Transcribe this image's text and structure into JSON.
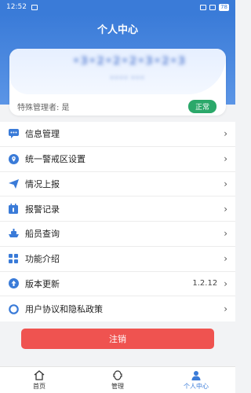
{
  "status_bar": {
    "time": "12:52",
    "battery": "78"
  },
  "header": {
    "title": "个人中心"
  },
  "profile": {
    "name_blurred": "•3•2•2•2•3•2•3",
    "sub_blurred": "•••• •••",
    "admin_label": "特殊管理者: 是",
    "status": "正常",
    "status_color": "#2ba86a"
  },
  "menu": {
    "items": [
      {
        "label": "信息管理",
        "icon": "message-icon"
      },
      {
        "label": "统一警戒区设置",
        "icon": "location-pin-icon"
      },
      {
        "label": "情况上报",
        "icon": "send-icon"
      },
      {
        "label": "报警记录",
        "icon": "calendar-icon"
      },
      {
        "label": "船员查询",
        "icon": "ship-icon"
      },
      {
        "label": "功能介绍",
        "icon": "grid-icon"
      },
      {
        "label": "版本更新",
        "icon": "upload-icon",
        "value": "1.2.12"
      },
      {
        "label": "用户协议和隐私政策",
        "icon": "circle-icon"
      }
    ]
  },
  "logout": {
    "label": "注销",
    "color": "#ef5350"
  },
  "tabbar": {
    "tabs": [
      {
        "label": "首页",
        "icon": "home-icon"
      },
      {
        "label": "管理",
        "icon": "manage-icon"
      },
      {
        "label": "个人中心",
        "icon": "user-icon",
        "active": true
      }
    ]
  },
  "colors": {
    "primary": "#3a7bd8"
  }
}
